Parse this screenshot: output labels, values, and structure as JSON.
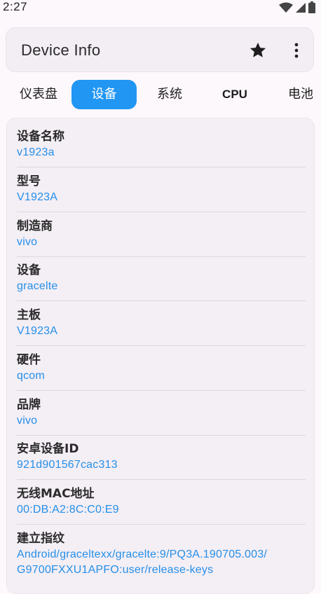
{
  "status_bar": {
    "time": "2:27"
  },
  "app_bar": {
    "title": "Device Info"
  },
  "tabs": [
    {
      "label": "仪表盘",
      "active": false
    },
    {
      "label": "设备",
      "active": true
    },
    {
      "label": "系统",
      "active": false
    },
    {
      "label": "CPU",
      "active": false
    },
    {
      "label": "电池",
      "active": false
    }
  ],
  "device": {
    "items": [
      {
        "label": "设备名称",
        "value": "v1923a"
      },
      {
        "label": "型号",
        "value": "V1923A"
      },
      {
        "label": "制造商",
        "value": "vivo"
      },
      {
        "label": "设备",
        "value": "gracelte"
      },
      {
        "label": "主板",
        "value": "V1923A"
      },
      {
        "label": "硬件",
        "value": "qcom"
      },
      {
        "label": "品牌",
        "value": "vivo"
      },
      {
        "label": "安卓设备ID",
        "value": "921d901567cac313"
      },
      {
        "label": "无线MAC地址",
        "value": "00:DB:A2:8C:C0:E9"
      },
      {
        "label": "建立指纹",
        "value": "Android/graceltexx/gracelte:9/PQ3A.190705.003/",
        "value2": "G9700FXXU1APFO:user/release-keys"
      }
    ]
  },
  "colors": {
    "accent": "#2196f3",
    "value_text": "#2590e8",
    "background": "#fdf8fc"
  }
}
